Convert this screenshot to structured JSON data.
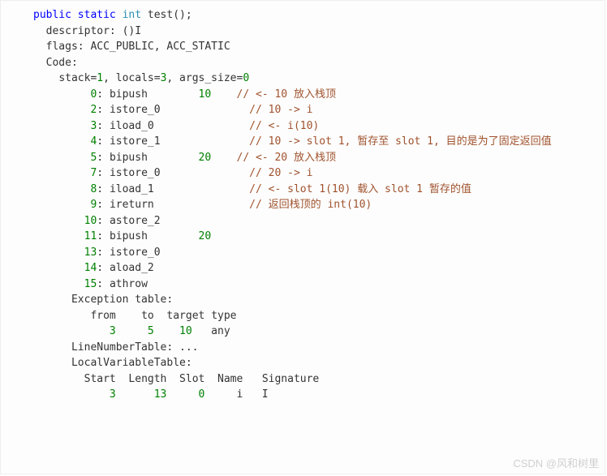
{
  "signature": {
    "kw_public": "public",
    "kw_static": "static",
    "type_int": "int",
    "name": "test();"
  },
  "descriptor_label": "descriptor:",
  "descriptor_value": "()I",
  "flags_label": "flags:",
  "flags_value": "ACC_PUBLIC, ACC_STATIC",
  "code_label": "Code:",
  "stack_line": {
    "stack_k": "stack=",
    "stack_v": "1",
    "locals_k": ", locals=",
    "locals_v": "3",
    "args_k": ", args_size=",
    "args_v": "0"
  },
  "instructions": [
    {
      "off": "0",
      "op": "bipush",
      "arg": "10",
      "comment": "// <- 10 放入栈顶"
    },
    {
      "off": "2",
      "op": "istore_0",
      "arg": "",
      "comment": "// 10 -> i"
    },
    {
      "off": "3",
      "op": "iload_0",
      "arg": "",
      "comment": "// <- i(10)"
    },
    {
      "off": "4",
      "op": "istore_1",
      "arg": "",
      "comment": "// 10 -> slot 1, 暂存至 slot 1, 目的是为了固定返回值"
    },
    {
      "off": "5",
      "op": "bipush",
      "arg": "20",
      "comment": "// <- 20 放入栈顶"
    },
    {
      "off": "7",
      "op": "istore_0",
      "arg": "",
      "comment": "// 20 -> i"
    },
    {
      "off": "8",
      "op": "iload_1",
      "arg": "",
      "comment": "// <- slot 1(10) 载入 slot 1 暂存的值"
    },
    {
      "off": "9",
      "op": "ireturn",
      "arg": "",
      "comment": "// 返回栈顶的 int(10)"
    },
    {
      "off": "10",
      "op": "astore_2",
      "arg": "",
      "comment": ""
    },
    {
      "off": "11",
      "op": "bipush",
      "arg": "20",
      "comment": ""
    },
    {
      "off": "13",
      "op": "istore_0",
      "arg": "",
      "comment": ""
    },
    {
      "off": "14",
      "op": "aload_2",
      "arg": "",
      "comment": ""
    },
    {
      "off": "15",
      "op": "athrow",
      "arg": "",
      "comment": ""
    }
  ],
  "exc_label": "Exception table:",
  "exc_header": {
    "from": "from",
    "to": "to",
    "target": "target",
    "type": "type"
  },
  "exc_row": {
    "from": "3",
    "to": "5",
    "target": "10",
    "type": "any"
  },
  "lnt": "LineNumberTable: ...",
  "lvt_label": "LocalVariableTable:",
  "lvt_header": {
    "start": "Start",
    "length": "Length",
    "slot": "Slot",
    "name": "Name",
    "sig": "Signature"
  },
  "lvt_row": {
    "start": "3",
    "length": "13",
    "slot": "0",
    "name": "i",
    "sig": "I"
  },
  "watermark": "CSDN @风和树里"
}
